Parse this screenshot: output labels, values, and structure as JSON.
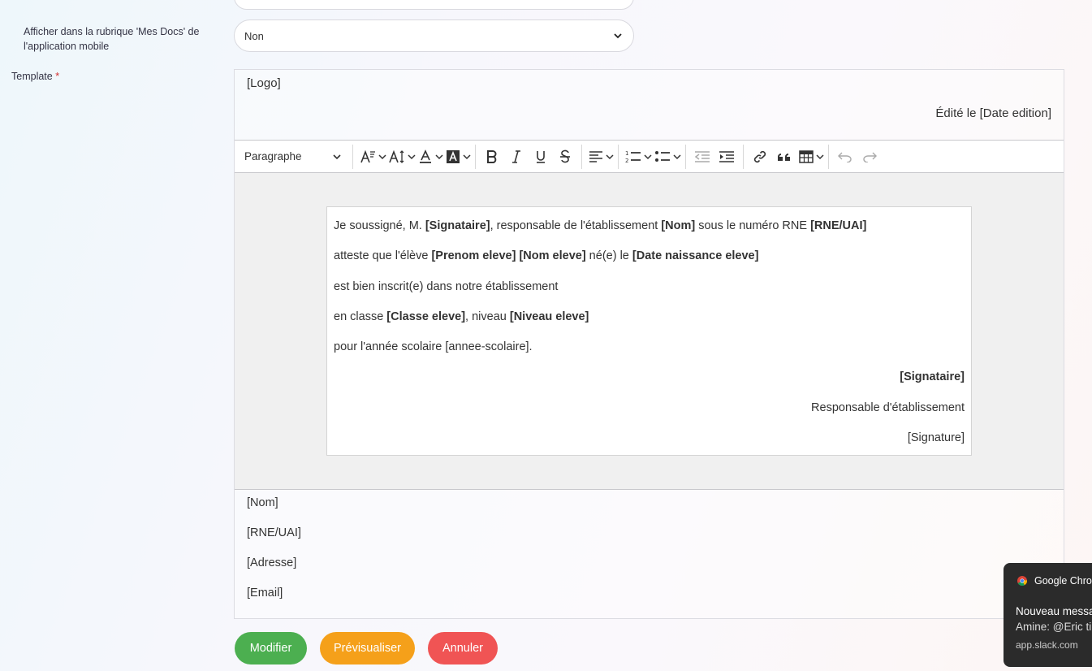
{
  "form": {
    "mobile_label": "Afficher dans la rubrique 'Mes Docs' de l'application mobile",
    "mobile_value": "Non",
    "template_label": "Template",
    "required_mark": "*"
  },
  "template": {
    "header": {
      "logo": "[Logo]",
      "date": "Édité le [Date edition]"
    },
    "toolbar": {
      "paragraph_style": "Paragraphe",
      "icons": [
        "font-size-icon",
        "text-height-icon",
        "font-color-icon",
        "background-color-icon",
        "bold-icon",
        "italic-icon",
        "underline-icon",
        "strikethrough-icon",
        "align-icon",
        "numbered-list-icon",
        "bulleted-list-icon",
        "outdent-icon",
        "indent-icon",
        "link-icon",
        "quote-icon",
        "table-icon",
        "undo-icon",
        "redo-icon"
      ]
    },
    "body": {
      "line1": {
        "a": "Je soussigné, M. ",
        "b": "[Signataire]",
        "c": ", responsable de l'établissement ",
        "d": "[Nom]",
        "e": " sous le numéro RNE ",
        "f": "[RNE/UAI]"
      },
      "line2": {
        "a": "atteste que l'élève ",
        "b": "[Prenom eleve] [Nom eleve]",
        "c": " né(e) le ",
        "d": "[Date naissance eleve]"
      },
      "line3": "est bien inscrit(e) dans notre établissement",
      "line4": {
        "a": "en classe ",
        "b": "[Classe eleve]",
        "c": ", niveau ",
        "d": "[Niveau eleve]"
      },
      "line5": "pour l'année scolaire [annee-scolaire].",
      "signataire": "[Signataire]",
      "role": "Responsable d'établissement",
      "signature": "[Signature]"
    },
    "footer": {
      "nom": "[Nom]",
      "rne": "[RNE/UAI]",
      "adresse": "[Adresse]",
      "email": "[Email]"
    }
  },
  "buttons": {
    "modifier": "Modifier",
    "preview": "Prévisualiser",
    "annuler": "Annuler"
  },
  "colors": {
    "modifier": "#4caf50",
    "preview": "#f5a01a",
    "annuler": "#f05454"
  },
  "notification": {
    "app": "Google Chrome",
    "title": "Nouveau message",
    "message": "Amine: @Eric ti",
    "source": "app.slack.com"
  }
}
